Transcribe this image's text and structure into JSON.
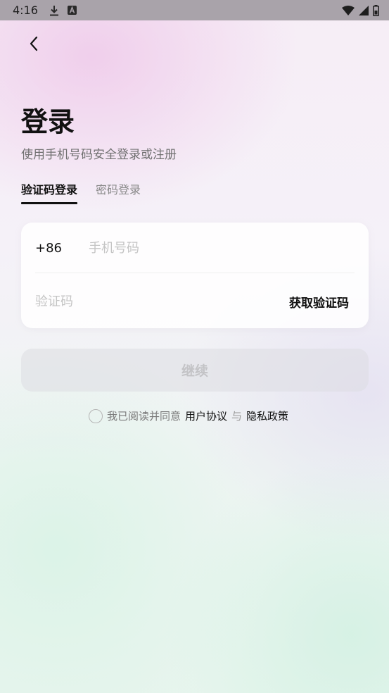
{
  "status_bar": {
    "time": "4:16",
    "left_icons": [
      "download-icon",
      "a-badge-icon"
    ],
    "right_icons": [
      "wifi-icon",
      "signal-icon",
      "battery-icon"
    ]
  },
  "header": {
    "back_icon": "chevron-left-icon",
    "title": "登录",
    "subtitle": "使用手机号码安全登录或注册"
  },
  "tabs": [
    {
      "label": "验证码登录",
      "active": true
    },
    {
      "label": "密码登录",
      "active": false
    }
  ],
  "form": {
    "country_code": "+86",
    "phone_placeholder": "手机号码",
    "phone_value": "",
    "code_placeholder": "验证码",
    "code_value": "",
    "get_code_label": "获取验证码"
  },
  "continue_button": {
    "label": "继续",
    "enabled": false
  },
  "agreement": {
    "checked": false,
    "prefix": "我已阅读并同意",
    "user_agreement": "用户协议",
    "connector": "与",
    "privacy_policy": "隐私政策"
  },
  "colors": {
    "primary_text": "#111111",
    "secondary_text": "#707070",
    "disabled_button_bg": "#dcdce2",
    "disabled_button_text": "#c3c3c6"
  }
}
